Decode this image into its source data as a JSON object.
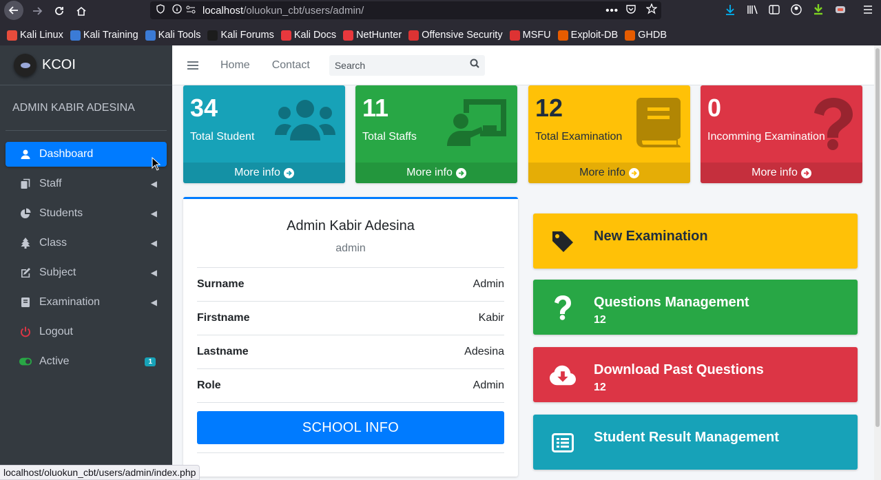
{
  "browser": {
    "url_host": "localhost",
    "url_path": "/oluokun_cbt/users/admin/",
    "bookmarks": [
      "Kali Linux",
      "Kali Training",
      "Kali Tools",
      "Kali Forums",
      "Kali Docs",
      "NetHunter",
      "Offensive Security",
      "MSFU",
      "Exploit-DB",
      "GHDB"
    ],
    "status_url": "localhost/oluokun_cbt/users/admin/index.php"
  },
  "brand": {
    "name": "KCOI"
  },
  "user_panel": {
    "name": "ADMIN KABIR ADESINA"
  },
  "sidebar": {
    "items": [
      {
        "label": "Dashboard",
        "icon": "user-icon",
        "active": true
      },
      {
        "label": "Staff",
        "icon": "copy-icon"
      },
      {
        "label": "Students",
        "icon": "pie-chart-icon"
      },
      {
        "label": "Class",
        "icon": "tree-icon"
      },
      {
        "label": "Subject",
        "icon": "edit-icon"
      },
      {
        "label": "Examination",
        "icon": "book-icon"
      },
      {
        "label": "Logout",
        "icon": "power-icon"
      },
      {
        "label": "Active",
        "icon": "toggle-on-icon",
        "badge": "1"
      }
    ]
  },
  "topnav": {
    "home": "Home",
    "contact": "Contact",
    "search_placeholder": "Search"
  },
  "stats": [
    {
      "value": "34",
      "label": "Total Student",
      "more": "More info",
      "color": "#17a2b8",
      "icon": "users-icon"
    },
    {
      "value": "11",
      "label": "Total Staffs",
      "more": "More info",
      "color": "#28a745",
      "icon": "chalkboard-teacher-icon"
    },
    {
      "value": "12",
      "label": "Total Examination",
      "more": "More info",
      "color": "#ffc107",
      "icon": "book-icon"
    },
    {
      "value": "0",
      "label": "Incomming Examination",
      "more": "More info",
      "color": "#dc3545",
      "icon": "question-icon"
    }
  ],
  "profile": {
    "name": "Admin Kabir Adesina",
    "role": "admin",
    "rows": [
      {
        "key": "Surname",
        "value": "Admin"
      },
      {
        "key": "Firstname",
        "value": "Kabir"
      },
      {
        "key": "Lastname",
        "value": "Adesina"
      },
      {
        "key": "Role",
        "value": "Admin"
      }
    ],
    "button": "SCHOOL INFO"
  },
  "actions": [
    {
      "title": "New Examination",
      "count": "",
      "color": "#ffc107",
      "icon": "tag-icon"
    },
    {
      "title": "Questions Management",
      "count": "12",
      "color": "#28a745",
      "icon": "question-icon"
    },
    {
      "title": "Download Past Questions",
      "count": "12",
      "color": "#dc3545",
      "icon": "cloud-download-icon"
    },
    {
      "title": "Student Result Management",
      "count": "",
      "color": "#17a2b8",
      "icon": "list-alt-icon"
    }
  ]
}
